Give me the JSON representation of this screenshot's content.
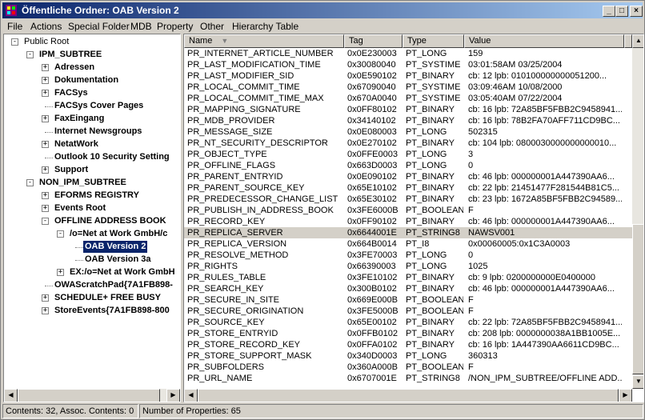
{
  "window": {
    "title": "Öffentliche Ordner: OAB Version 2",
    "minimize_glyph": "_",
    "maximize_glyph": "□",
    "close_glyph": "×"
  },
  "menu": [
    "File",
    "Actions",
    "Special Folder",
    "MDB",
    "Property",
    "Other",
    "Hierarchy Table"
  ],
  "tree": {
    "items": [
      {
        "label": "Public Root",
        "level": 0,
        "toggle": "-",
        "bold": false
      },
      {
        "label": "IPM_SUBTREE",
        "level": 1,
        "toggle": "-",
        "bold": true
      },
      {
        "label": "Adressen",
        "level": 2,
        "toggle": "+",
        "bold": true
      },
      {
        "label": "Dokumentation",
        "level": 2,
        "toggle": "+",
        "bold": true
      },
      {
        "label": "FACSys",
        "level": 2,
        "toggle": "+",
        "bold": true
      },
      {
        "label": "FACSys Cover Pages",
        "level": 2,
        "toggle": "",
        "bold": true
      },
      {
        "label": "FaxEingang",
        "level": 2,
        "toggle": "+",
        "bold": true
      },
      {
        "label": "Internet Newsgroups",
        "level": 2,
        "toggle": "",
        "bold": true
      },
      {
        "label": "NetatWork",
        "level": 2,
        "toggle": "+",
        "bold": true
      },
      {
        "label": "Outlook 10 Security Setting",
        "level": 2,
        "toggle": "",
        "bold": true
      },
      {
        "label": "Support",
        "level": 2,
        "toggle": "+",
        "bold": true
      },
      {
        "label": "NON_IPM_SUBTREE",
        "level": 1,
        "toggle": "-",
        "bold": true
      },
      {
        "label": "EFORMS REGISTRY",
        "level": 2,
        "toggle": "+",
        "bold": true
      },
      {
        "label": "Events Root",
        "level": 2,
        "toggle": "+",
        "bold": true
      },
      {
        "label": "OFFLINE ADDRESS BOOK",
        "level": 2,
        "toggle": "-",
        "bold": true
      },
      {
        "label": "/o=Net at Work GmbH/c",
        "level": 3,
        "toggle": "-",
        "bold": true
      },
      {
        "label": "OAB Version 2",
        "level": 4,
        "toggle": "",
        "bold": true,
        "selected": true
      },
      {
        "label": "OAB Version 3a",
        "level": 4,
        "toggle": "",
        "bold": true
      },
      {
        "label": "EX:/o=Net at Work GmbH",
        "level": 3,
        "toggle": "+",
        "bold": true
      },
      {
        "label": "OWAScratchPad{7A1FB898-",
        "level": 2,
        "toggle": "",
        "bold": true
      },
      {
        "label": "SCHEDULE+ FREE BUSY",
        "level": 2,
        "toggle": "+",
        "bold": true
      },
      {
        "label": "StoreEvents{7A1FB898-800",
        "level": 2,
        "toggle": "+",
        "bold": true
      }
    ]
  },
  "list": {
    "columns": [
      "Name",
      "Tag",
      "Type",
      "Value"
    ],
    "sort_indicator": "▼",
    "rows": [
      [
        "PR_INTERNET_ARTICLE_NUMBER",
        "0x0E230003",
        "PT_LONG",
        "159"
      ],
      [
        "PR_LAST_MODIFICATION_TIME",
        "0x30080040",
        "PT_SYSTIME",
        "03:01:58AM  03/25/2004"
      ],
      [
        "PR_LAST_MODIFIER_SID",
        "0x0E590102",
        "PT_BINARY",
        "cb: 12 lpb: 010100000000051200..."
      ],
      [
        "PR_LOCAL_COMMIT_TIME",
        "0x67090040",
        "PT_SYSTIME",
        "03:09:46AM  10/08/2000"
      ],
      [
        "PR_LOCAL_COMMIT_TIME_MAX",
        "0x670A0040",
        "PT_SYSTIME",
        "03:05:40AM  07/22/2004"
      ],
      [
        "PR_MAPPING_SIGNATURE",
        "0x0FF80102",
        "PT_BINARY",
        "cb: 16 lpb: 72A85BF5FBB2C9458941..."
      ],
      [
        "PR_MDB_PROVIDER",
        "0x34140102",
        "PT_BINARY",
        "cb: 16 lpb: 78B2FA70AFF711CD9BC..."
      ],
      [
        "PR_MESSAGE_SIZE",
        "0x0E080003",
        "PT_LONG",
        "502315"
      ],
      [
        "PR_NT_SECURITY_DESCRIPTOR",
        "0x0E270102",
        "PT_BINARY",
        "cb: 104 lpb: 0800030000000000010..."
      ],
      [
        "PR_OBJECT_TYPE",
        "0x0FFE0003",
        "PT_LONG",
        "3"
      ],
      [
        "PR_OFFLINE_FLAGS",
        "0x663D0003",
        "PT_LONG",
        "0"
      ],
      [
        "PR_PARENT_ENTRYID",
        "0x0E090102",
        "PT_BINARY",
        "cb: 46 lpb: 000000001A447390AA6..."
      ],
      [
        "PR_PARENT_SOURCE_KEY",
        "0x65E10102",
        "PT_BINARY",
        "cb: 22 lpb: 21451477F281544B81C5..."
      ],
      [
        "PR_PREDECESSOR_CHANGE_LIST",
        "0x65E30102",
        "PT_BINARY",
        "cb: 23 lpb: 1672A85BF5FBB2C94589..."
      ],
      [
        "PR_PUBLISH_IN_ADDRESS_BOOK",
        "0x3FE6000B",
        "PT_BOOLEAN",
        "F"
      ],
      [
        "PR_RECORD_KEY",
        "0x0FF90102",
        "PT_BINARY",
        "cb: 46 lpb: 000000001A447390AA6..."
      ],
      [
        "PR_REPLICA_SERVER",
        "0x6644001E",
        "PT_STRING8",
        "NAWSV001"
      ],
      [
        "PR_REPLICA_VERSION",
        "0x664B0014",
        "PT_I8",
        "0x00060005:0x1C3A0003"
      ],
      [
        "PR_RESOLVE_METHOD",
        "0x3FE70003",
        "PT_LONG",
        "0"
      ],
      [
        "PR_RIGHTS",
        "0x66390003",
        "PT_LONG",
        "1025"
      ],
      [
        "PR_RULES_TABLE",
        "0x3FE10102",
        "PT_BINARY",
        "cb: 9 lpb: 0200000000E0400000"
      ],
      [
        "PR_SEARCH_KEY",
        "0x300B0102",
        "PT_BINARY",
        "cb: 46 lpb: 000000001A447390AA6..."
      ],
      [
        "PR_SECURE_IN_SITE",
        "0x669E000B",
        "PT_BOOLEAN",
        "F"
      ],
      [
        "PR_SECURE_ORIGINATION",
        "0x3FE5000B",
        "PT_BOOLEAN",
        "F"
      ],
      [
        "PR_SOURCE_KEY",
        "0x65E00102",
        "PT_BINARY",
        "cb: 22 lpb: 72A85BF5FBB2C9458941..."
      ],
      [
        "PR_STORE_ENTRYID",
        "0x0FFB0102",
        "PT_BINARY",
        "cb: 208 lpb: 0000000038A1BB1005E..."
      ],
      [
        "PR_STORE_RECORD_KEY",
        "0x0FFA0102",
        "PT_BINARY",
        "cb: 16 lpb: 1A447390AA6611CD9BC..."
      ],
      [
        "PR_STORE_SUPPORT_MASK",
        "0x340D0003",
        "PT_LONG",
        "360313"
      ],
      [
        "PR_SUBFOLDERS",
        "0x360A000B",
        "PT_BOOLEAN",
        "F"
      ],
      [
        "PR_URL_NAME",
        "0x6707001E",
        "PT_STRING8",
        "/NON_IPM_SUBTREE/OFFLINE ADD..."
      ]
    ],
    "highlighted_row": 16
  },
  "status": {
    "left": "Contents: 32, Assoc. Contents: 0",
    "right": "Number of Properties: 65"
  },
  "colors": {
    "title_start": "#0a246a",
    "title_end": "#a6caf0",
    "selection": "#0a246a",
    "face": "#d4d0c8"
  }
}
